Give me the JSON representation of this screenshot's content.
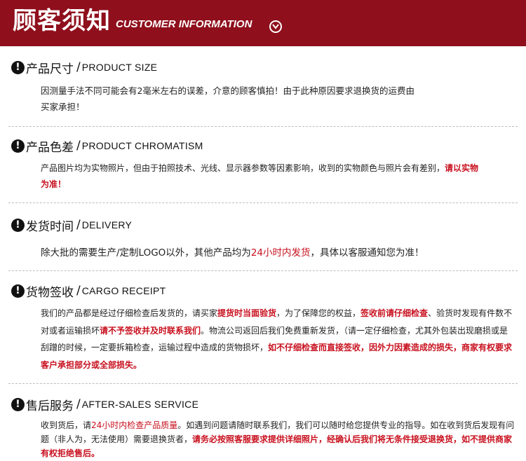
{
  "header": {
    "title": "顾客须知",
    "subtitle": "CUSTOMER INFORMATION"
  },
  "sections": [
    {
      "title_cn": "产品尺寸",
      "title_en": "PRODUCT SIZE",
      "body": [
        {
          "text": "因测量手法不同可能会有2毫米左右的误差，介意的顾客慎拍！由于此种原因要求退换货的运费由",
          "style": "normal"
        },
        {
          "text": "买家承担！",
          "style": "normal"
        }
      ]
    },
    {
      "title_cn": "产品色差",
      "title_en": "PRODUCT CHROMATISM",
      "body": [
        {
          "text": "产品图片均为实物照片，但由于拍照技术、光线、显示器参数等因素影响，收到的实物颜色与照片会有差别，",
          "style": "normal"
        },
        {
          "text": "请以实物",
          "style": "red"
        },
        {
          "text": "为准！",
          "style": "red"
        }
      ]
    },
    {
      "title_cn": "发货时间",
      "title_en": "DELIVERY",
      "body": [
        {
          "text": "除大批的需要生产/定制LOGO以外，其他产品均为",
          "style": "normal"
        },
        {
          "text": "24小时内发货",
          "style": "red"
        },
        {
          "text": "，具体以客服通知您为准！",
          "style": "normal"
        }
      ]
    },
    {
      "title_cn": "货物签收",
      "title_en": "CARGO RECEIPT",
      "body": [
        {
          "text": "我们的产品都是经过仔细检查后发货的，请买家",
          "style": "normal"
        },
        {
          "text": "提货时当面验货",
          "style": "redb"
        },
        {
          "text": "，为了保障您的权益，",
          "style": "normal"
        },
        {
          "text": "签收前请仔细检查",
          "style": "redb"
        },
        {
          "text": "、验货时发现有件数不对或者运输损坏",
          "style": "normal"
        },
        {
          "text": "请不予签收并及时联系我们",
          "style": "redb"
        },
        {
          "text": "。物流公司返回后我们免费重新发货，（请一定仔细检查，尤其外包装出现磨损或是刮蹭的时候，一定要拆箱检查，运输过程中造成的货物损坏，",
          "style": "normal"
        },
        {
          "text": "如不仔细检查而直接签收，因外力因素造成的损失，商家有权要求客户承担部分或全部损失。",
          "style": "redb"
        }
      ]
    },
    {
      "title_cn": "售后服务",
      "title_en": "AFTER-SALES SERVICE",
      "body": [
        {
          "text": "收到货后，请",
          "style": "normal"
        },
        {
          "text": "24小时内检查产品质量",
          "style": "red"
        },
        {
          "text": "。如遇到问题请随时联系我们，我们可以随时给您提供专业的指导。如在收到货后发现有问题（非人为，无法使用）需要退换货者，",
          "style": "normal"
        },
        {
          "text": "请务必按照客服要求提供详细照片，经确认后我们将无条件接受退换货，如不提供商家有权拒绝售后。",
          "style": "redb"
        }
      ]
    }
  ]
}
